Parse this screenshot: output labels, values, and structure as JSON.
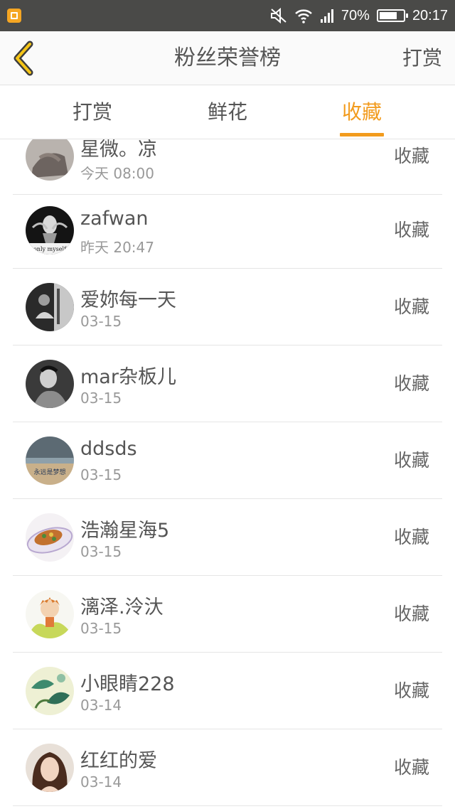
{
  "status_bar": {
    "battery_percent": "70%",
    "time": "20:17"
  },
  "header": {
    "title": "粉丝荣誉榜",
    "reward_button": "打赏"
  },
  "tabs": [
    {
      "label": "打赏",
      "active": false
    },
    {
      "label": "鲜花",
      "active": false
    },
    {
      "label": "收藏",
      "active": true
    }
  ],
  "list": [
    {
      "name": "星微。凉",
      "time": "今天 08:00",
      "action": "收藏"
    },
    {
      "name": "zafwan",
      "time": "昨天 20:47",
      "action": "收藏",
      "avatar_caption": "only myself"
    },
    {
      "name": "爱妳每一天",
      "time": "03-15",
      "action": "收藏"
    },
    {
      "name": "mar杂板儿",
      "time": "03-15",
      "action": "收藏"
    },
    {
      "name": "ddsds",
      "time": "03-15",
      "action": "收藏",
      "avatar_caption": "永远是梦想"
    },
    {
      "name": "浩瀚星海5",
      "time": "03-15",
      "action": "收藏"
    },
    {
      "name": "漓泽.泠汏",
      "time": "03-15",
      "action": "收藏"
    },
    {
      "name": "小眼睛228",
      "time": "03-14",
      "action": "收藏"
    },
    {
      "name": "红红的爱",
      "time": "03-14",
      "action": "收藏"
    }
  ],
  "colors": {
    "accent": "#f29b1d",
    "status_bar": "#4a4a48",
    "header_bg": "#fafafa"
  }
}
